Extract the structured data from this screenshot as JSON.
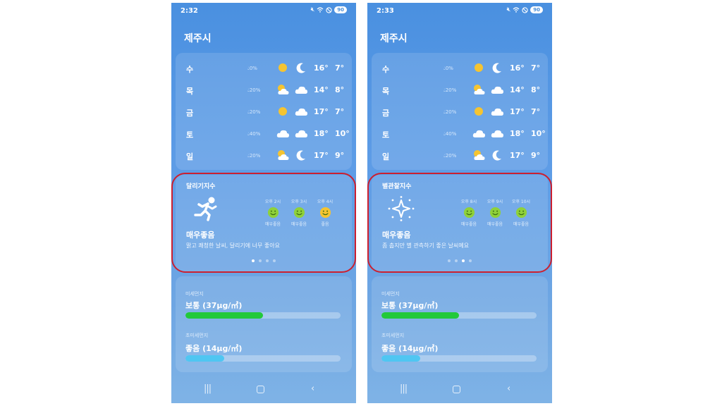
{
  "screens": [
    {
      "status_time": "2:32",
      "battery": "90",
      "city": "제주시",
      "forecast": [
        {
          "day": "수",
          "precip": "0%",
          "icon_day": "sun-icon",
          "icon_night": "moon-icon",
          "high": "16°",
          "low": "7°"
        },
        {
          "day": "목",
          "precip": "20%",
          "icon_day": "sun-cloud-icon",
          "icon_night": "cloud-icon",
          "high": "14°",
          "low": "8°"
        },
        {
          "day": "금",
          "precip": "20%",
          "icon_day": "sun-icon",
          "icon_night": "cloud-icon",
          "high": "17°",
          "low": "7°"
        },
        {
          "day": "토",
          "precip": "40%",
          "icon_day": "cloud-icon",
          "icon_night": "cloud-icon",
          "high": "18°",
          "low": "10°"
        },
        {
          "day": "일",
          "precip": "20%",
          "icon_day": "sun-cloud-icon",
          "icon_night": "moon-icon",
          "high": "17°",
          "low": "9°"
        }
      ],
      "index": {
        "title": "달리기지수",
        "icon": "runner-icon",
        "rating": "매우좋음",
        "description": "맑고 쾌청한 날씨, 달리기에 너무 좋아요",
        "hours": [
          {
            "time": "오후 2시",
            "rating": "매우좋음",
            "face_color": "#8fd13a"
          },
          {
            "time": "오후 3시",
            "rating": "매우좋음",
            "face_color": "#8fd13a"
          },
          {
            "time": "오후 4시",
            "rating": "좋음",
            "face_color": "#f5c431"
          }
        ],
        "active_page": 0
      },
      "pm10": {
        "label": "미세먼지",
        "value": "보통 (37μg/㎥)",
        "level": 0.5,
        "color": "#22c93a"
      },
      "pm25": {
        "label": "초미세먼지",
        "value": "좋음 (14μg/㎥)",
        "level": 0.25,
        "color": "#4fc6f2"
      }
    },
    {
      "status_time": "2:33",
      "battery": "90",
      "city": "제주시",
      "forecast": [
        {
          "day": "수",
          "precip": "0%",
          "icon_day": "sun-icon",
          "icon_night": "moon-icon",
          "high": "16°",
          "low": "7°"
        },
        {
          "day": "목",
          "precip": "20%",
          "icon_day": "sun-cloud-icon",
          "icon_night": "cloud-icon",
          "high": "14°",
          "low": "8°"
        },
        {
          "day": "금",
          "precip": "20%",
          "icon_day": "sun-icon",
          "icon_night": "cloud-icon",
          "high": "17°",
          "low": "7°"
        },
        {
          "day": "토",
          "precip": "40%",
          "icon_day": "cloud-icon",
          "icon_night": "cloud-icon",
          "high": "18°",
          "low": "10°"
        },
        {
          "day": "일",
          "precip": "20%",
          "icon_day": "sun-cloud-icon",
          "icon_night": "moon-icon",
          "high": "17°",
          "low": "9°"
        }
      ],
      "index": {
        "title": "별관찰지수",
        "icon": "sparkle-star-icon",
        "rating": "매우좋음",
        "description": "좀 춥지만 별 관측하기 좋은 날씨예요",
        "hours": [
          {
            "time": "오후 8시",
            "rating": "매우좋음",
            "face_color": "#8fd13a"
          },
          {
            "time": "오후 9시",
            "rating": "매우좋음",
            "face_color": "#8fd13a"
          },
          {
            "time": "오후 10시",
            "rating": "매우좋음",
            "face_color": "#8fd13a"
          }
        ],
        "active_page": 2
      },
      "pm10": {
        "label": "미세먼지",
        "value": "보통 (37μg/㎥)",
        "level": 0.5,
        "color": "#22c93a"
      },
      "pm25": {
        "label": "초미세먼지",
        "value": "좋음 (14μg/㎥)",
        "level": 0.25,
        "color": "#4fc6f2"
      }
    }
  ],
  "highlight_color": "#cc1f2f",
  "page_dot_count": 4
}
